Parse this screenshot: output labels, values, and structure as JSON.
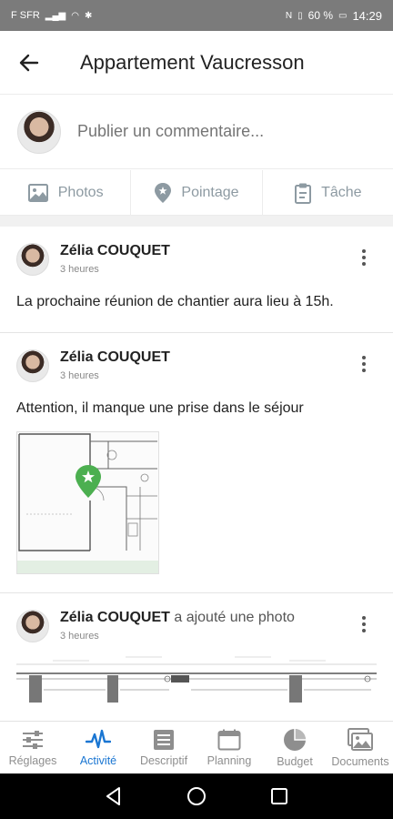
{
  "status_bar": {
    "carrier": "F SFR",
    "battery": "60 %",
    "time": "14:29"
  },
  "app_bar": {
    "title": "Appartement Vaucresson"
  },
  "composer": {
    "placeholder": "Publier un commentaire..."
  },
  "actions": [
    {
      "label": "Photos",
      "icon": "image-icon"
    },
    {
      "label": "Pointage",
      "icon": "location-pin-icon"
    },
    {
      "label": "Tâche",
      "icon": "clipboard-icon"
    }
  ],
  "feed": [
    {
      "author": "Zélia COUQUET",
      "action": "",
      "time": "3 heures",
      "text": "La prochaine réunion de chantier aura lieu à 15h."
    },
    {
      "author": "Zélia COUQUET",
      "action": "",
      "time": "3 heures",
      "text": "Attention, il manque une prise dans le séjour"
    },
    {
      "author": "Zélia COUQUET",
      "action": "a ajouté une photo",
      "time": "3 heures",
      "text": ""
    }
  ],
  "bottom_nav": [
    {
      "label": "Réglages",
      "icon": "sliders-icon",
      "active": false
    },
    {
      "label": "Activité",
      "icon": "activity-icon",
      "active": true
    },
    {
      "label": "Descriptif",
      "icon": "list-icon",
      "active": false
    },
    {
      "label": "Planning",
      "icon": "calendar-icon",
      "active": false
    },
    {
      "label": "Budget",
      "icon": "pie-chart-icon",
      "active": false
    },
    {
      "label": "Documents",
      "icon": "documents-icon",
      "active": false
    }
  ],
  "colors": {
    "accent": "#1a76d2",
    "pin": "#4caf50",
    "status_bar": "#7b7b7b",
    "muted": "#8d9aa2"
  }
}
